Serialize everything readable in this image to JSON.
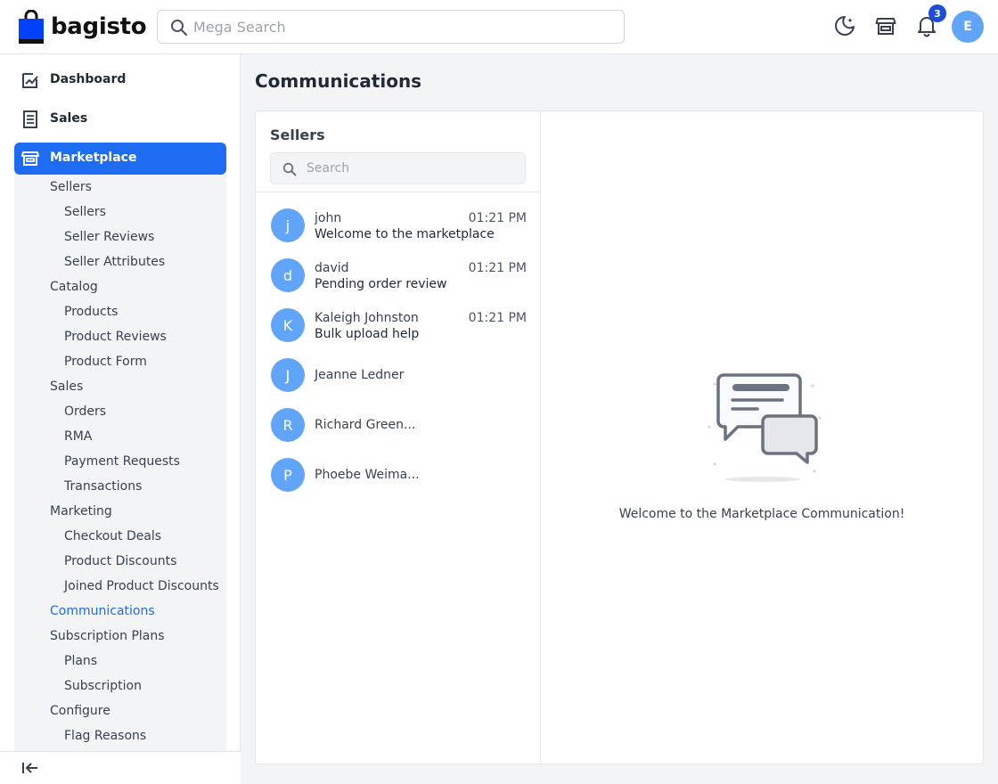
{
  "header": {
    "logo_text": "bagisto",
    "search_placeholder": "Mega Search",
    "notification_count": "3",
    "user_initial": "E",
    "icons": [
      "moon-icon",
      "store-icon",
      "bell-icon"
    ]
  },
  "sidebar": {
    "nav": [
      {
        "label": "Dashboard",
        "icon": "dashboard-icon"
      },
      {
        "label": "Sales",
        "icon": "sales-icon"
      },
      {
        "label": "Marketplace",
        "icon": "store-icon",
        "active": true
      }
    ],
    "submenu": [
      {
        "label": "Sellers",
        "level": 1
      },
      {
        "label": "Sellers",
        "level": 2
      },
      {
        "label": "Seller Reviews",
        "level": 2
      },
      {
        "label": "Seller Attributes",
        "level": 2
      },
      {
        "label": "Catalog",
        "level": 1
      },
      {
        "label": "Products",
        "level": 2
      },
      {
        "label": "Product Reviews",
        "level": 2
      },
      {
        "label": "Product Form",
        "level": 2
      },
      {
        "label": "Sales",
        "level": 1
      },
      {
        "label": "Orders",
        "level": 2
      },
      {
        "label": "RMA",
        "level": 2
      },
      {
        "label": "Payment Requests",
        "level": 2
      },
      {
        "label": "Transactions",
        "level": 2
      },
      {
        "label": "Marketing",
        "level": 1
      },
      {
        "label": "Checkout Deals",
        "level": 2
      },
      {
        "label": "Product Discounts",
        "level": 2
      },
      {
        "label": "Joined Product Discounts",
        "level": 2
      },
      {
        "label": "Communications",
        "level": 1,
        "active": true
      },
      {
        "label": "Subscription Plans",
        "level": 1
      },
      {
        "label": "Plans",
        "level": 2
      },
      {
        "label": "Subscription",
        "level": 2
      },
      {
        "label": "Configure",
        "level": 1
      },
      {
        "label": "Flag Reasons",
        "level": 2
      }
    ]
  },
  "main": {
    "title": "Communications",
    "sellers_heading": "Sellers",
    "search_placeholder": "Search",
    "conversations": [
      {
        "initial": "j",
        "name": "john",
        "time": "01:21 PM",
        "message": "Welcome to the marketplace"
      },
      {
        "initial": "d",
        "name": "david",
        "time": "01:21 PM",
        "message": "Pending order review"
      },
      {
        "initial": "K",
        "name": "Kaleigh Johnston",
        "time": "01:21 PM",
        "message": "Bulk upload help"
      },
      {
        "initial": "J",
        "name": "Jeanne Ledner",
        "time": "",
        "message": ""
      },
      {
        "initial": "R",
        "name": "Richard Green...",
        "time": "",
        "message": ""
      },
      {
        "initial": "P",
        "name": "Phoebe Weima...",
        "time": "",
        "message": ""
      }
    ],
    "empty_text": "Welcome to the Marketplace Communication!"
  },
  "colors": {
    "accent": "#1d6cf2",
    "avatar": "#60a5fa",
    "badge": "#1d4ed8"
  }
}
